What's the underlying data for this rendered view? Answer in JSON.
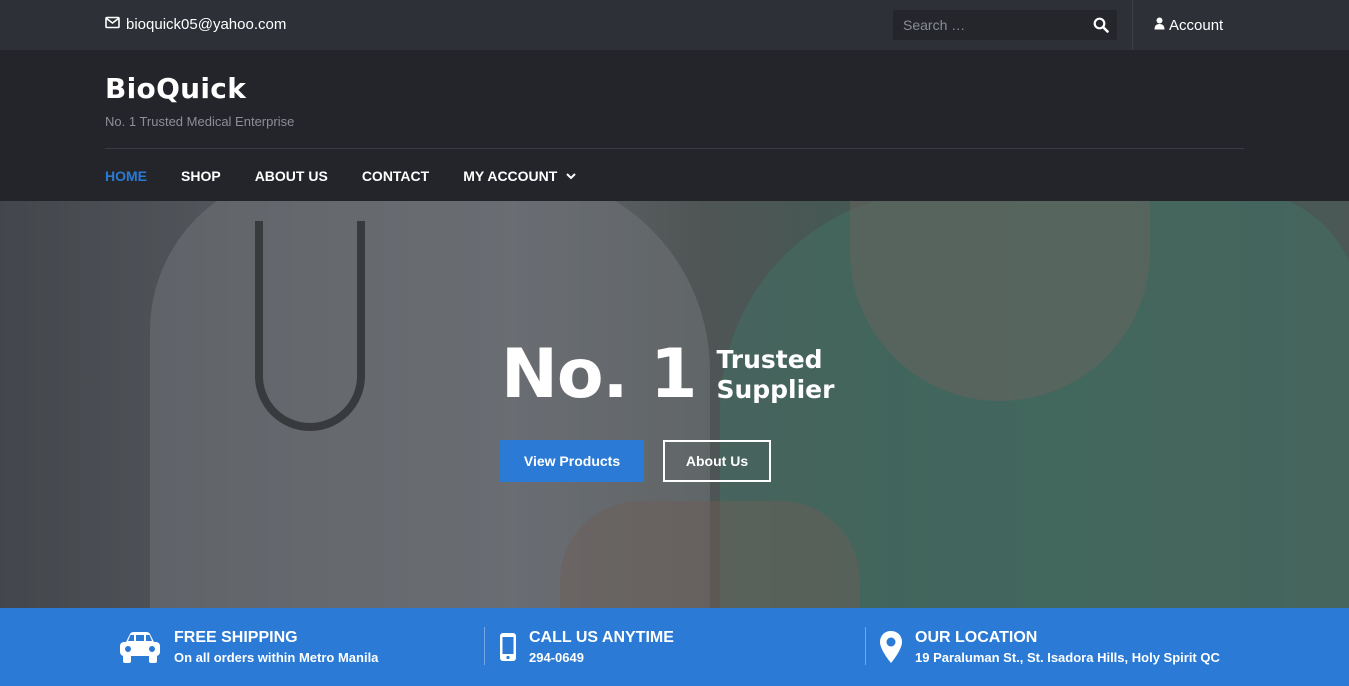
{
  "topbar": {
    "email": "bioquick05@yahoo.com",
    "search_placeholder": "Search …",
    "account_label": "Account"
  },
  "header": {
    "site_title": "BioQuick",
    "tagline": "No. 1 Trusted Medical Enterprise"
  },
  "nav": {
    "items": [
      {
        "label": "HOME",
        "active": true
      },
      {
        "label": "SHOP",
        "active": false
      },
      {
        "label": "ABOUT US",
        "active": false
      },
      {
        "label": "CONTACT",
        "active": false
      },
      {
        "label": "MY ACCOUNT",
        "active": false,
        "has_dropdown": true
      }
    ]
  },
  "hero": {
    "title_big": "No. 1",
    "title_line1": "Trusted",
    "title_line2": "Supplier",
    "primary_button": "View Products",
    "secondary_button": "About Us"
  },
  "features": [
    {
      "icon": "car-icon",
      "title": "FREE SHIPPING",
      "subtitle": "On all orders within Metro Manila"
    },
    {
      "icon": "mobile-phone-icon",
      "title": "CALL US ANYTIME",
      "subtitle": "294-0649"
    },
    {
      "icon": "map-pin-icon",
      "title": "OUR LOCATION",
      "subtitle": "19 Paraluman St., St. Isadora Hills, Holy Spirit QC"
    }
  ],
  "colors": {
    "accent": "#2a7ad6",
    "topbar_bg": "#2e3038",
    "header_bg": "#24252b"
  }
}
